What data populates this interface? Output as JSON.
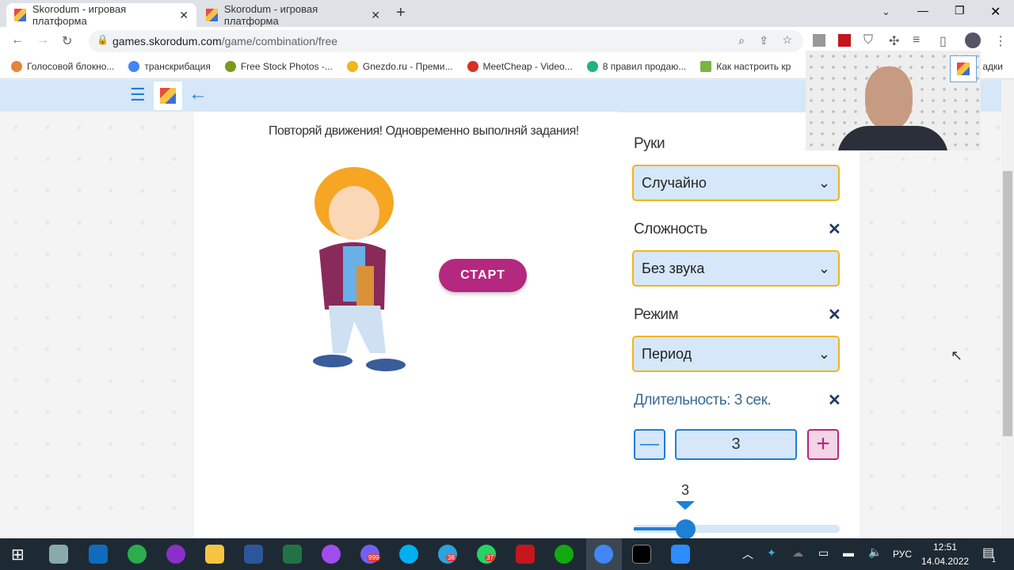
{
  "browser": {
    "tabs": [
      {
        "title": "Skorodum - игровая платформа"
      },
      {
        "title": "Skorodum - игровая платформа"
      }
    ],
    "url_host": "games.skorodum.com",
    "url_path": "/game/combination/free",
    "bookmarks": [
      {
        "label": "Голосовой блокно...",
        "color": "#e8833a"
      },
      {
        "label": "транскрибация",
        "color": "#4285f4"
      },
      {
        "label": "Free Stock Photos -...",
        "color": "#7a9a1e"
      },
      {
        "label": "Gnezdo.ru - Преми...",
        "color": "#f2b51c"
      },
      {
        "label": "MeetCheap - Video...",
        "color": "#d93025"
      },
      {
        "label": "8 правил продаю...",
        "color": "#1fb57a"
      },
      {
        "label": "Как настроить кр",
        "color": "#7cb342"
      },
      {
        "label": "адки",
        "color": "#999"
      }
    ]
  },
  "game": {
    "instruction": "Повторяй движения! Одновременно выполняй задания!",
    "start_label": "СТАРТ"
  },
  "settings": {
    "hands": {
      "label": "Руки",
      "value": "Случайно"
    },
    "difficulty": {
      "label": "Сложность",
      "value": "Без звука"
    },
    "mode": {
      "label": "Режим",
      "value": "Период"
    },
    "duration": {
      "label": "Длительность: 3 сек.",
      "value": "3",
      "slider_value": "3",
      "slider_fraction": 0.25
    }
  },
  "colors": {
    "accent": "#1e7fd4",
    "start": "#b5287f",
    "select_border": "#f2b51c"
  },
  "taskbar": {
    "lang": "РУС",
    "time": "12:51",
    "date": "14.04.2022",
    "badges": {
      "viber": "999",
      "telegram": "38",
      "whatsapp": "37"
    },
    "notifications": "1"
  }
}
